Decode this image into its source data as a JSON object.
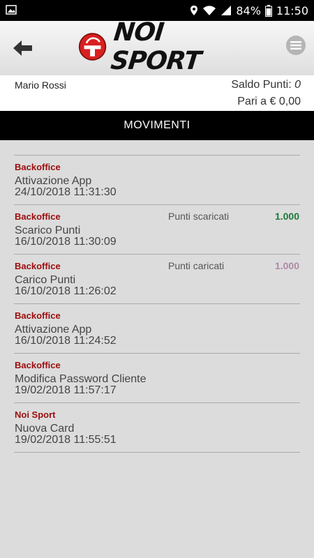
{
  "status_bar": {
    "battery": "84%",
    "time": "11:50"
  },
  "header": {
    "logo_text": "NOI SPORT"
  },
  "user": {
    "name": "Mario Rossi",
    "saldo_label": "Saldo Punti:",
    "saldo_value": "0",
    "pari_text": "Pari a € 0,00"
  },
  "tab": {
    "title": "MOVIMENTI"
  },
  "movements": [
    {
      "source": "Backoffice",
      "type": "Attivazione App",
      "date": "24/10/2018 11:31:30",
      "label": "",
      "points": ""
    },
    {
      "source": "Backoffice",
      "type": "Scarico Punti",
      "date": "16/10/2018 11:30:09",
      "label": "Punti scaricati",
      "points": "1.000",
      "points_color": "#1a7a3a"
    },
    {
      "source": "Backoffice",
      "type": "Carico Punti",
      "date": "16/10/2018 11:26:02",
      "label": "Punti caricati",
      "points": "1.000",
      "points_color": "#b08aa6"
    },
    {
      "source": "Backoffice",
      "type": "Attivazione App",
      "date": "16/10/2018 11:24:52",
      "label": "",
      "points": ""
    },
    {
      "source": "Backoffice",
      "type": "Modifica Password Cliente",
      "date": "19/02/2018 11:57:17",
      "label": "",
      "points": ""
    },
    {
      "source": "Noi Sport",
      "type": "Nuova Card",
      "date": "19/02/2018 11:55:51",
      "label": "",
      "points": ""
    }
  ],
  "colors": {
    "source_red": "#9b0d0d",
    "background": "#dcdcdc"
  },
  "icons": {
    "status_left": "image-icon",
    "back": "back-arrow-icon",
    "menu": "menu-icon"
  }
}
